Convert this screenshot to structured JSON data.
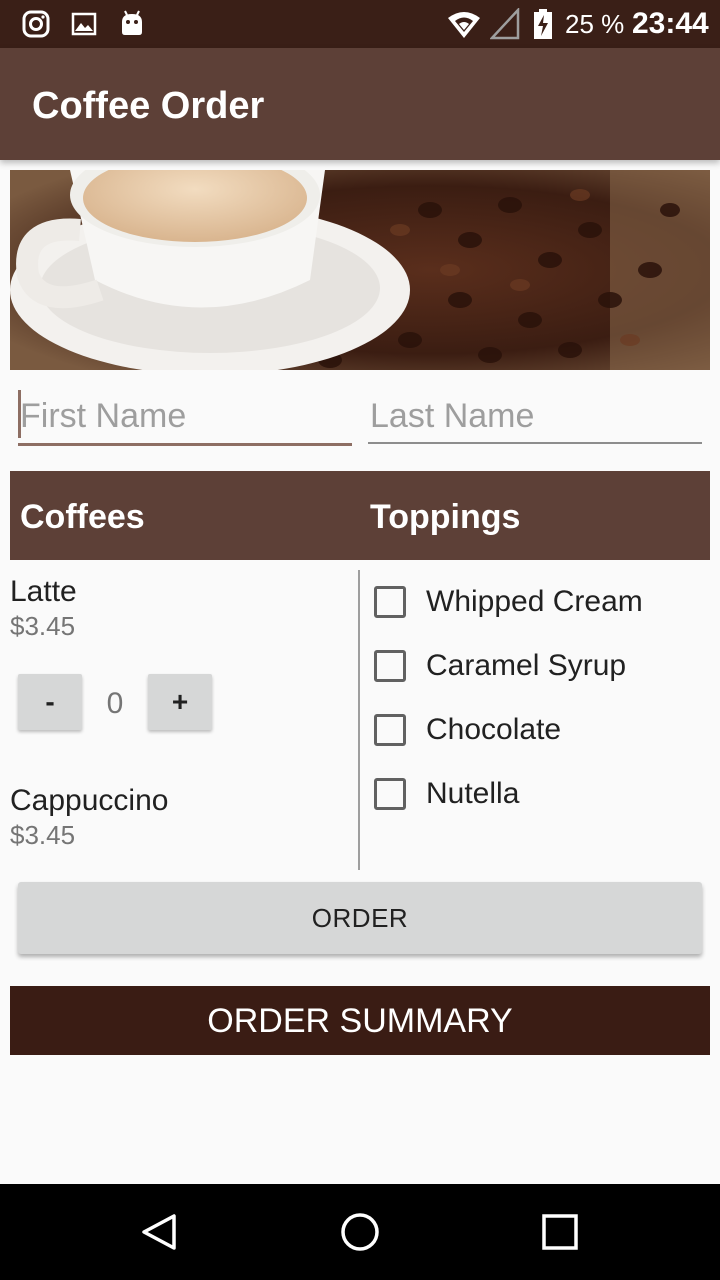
{
  "status_bar": {
    "icons_left": [
      "instagram-icon",
      "image-icon",
      "android-icon"
    ],
    "battery_percent": "25 %",
    "time": "23:44"
  },
  "app_bar": {
    "title": "Coffee Order"
  },
  "form": {
    "first_name_placeholder": "First Name",
    "last_name_placeholder": "Last Name"
  },
  "sections": {
    "coffees": "Coffees",
    "toppings": "Toppings"
  },
  "coffees": [
    {
      "name": "Latte",
      "price": "$3.45",
      "quantity": "0"
    },
    {
      "name": "Cappuccino",
      "price": "$3.45"
    }
  ],
  "stepper": {
    "minus": "-",
    "plus": "+"
  },
  "toppings": [
    {
      "label": "Whipped Cream",
      "checked": false
    },
    {
      "label": "Caramel Syrup",
      "checked": false
    },
    {
      "label": "Chocolate",
      "checked": false
    },
    {
      "label": "Nutella",
      "checked": false
    }
  ],
  "buttons": {
    "order": "ORDER",
    "order_summary": "ORDER SUMMARY"
  },
  "colors": {
    "primary": "#5d4037",
    "primary_dark": "#3a1f17",
    "accent": "#8d6e63"
  },
  "nav_bar": {
    "icons": [
      "back-icon",
      "home-icon",
      "recents-icon"
    ]
  }
}
